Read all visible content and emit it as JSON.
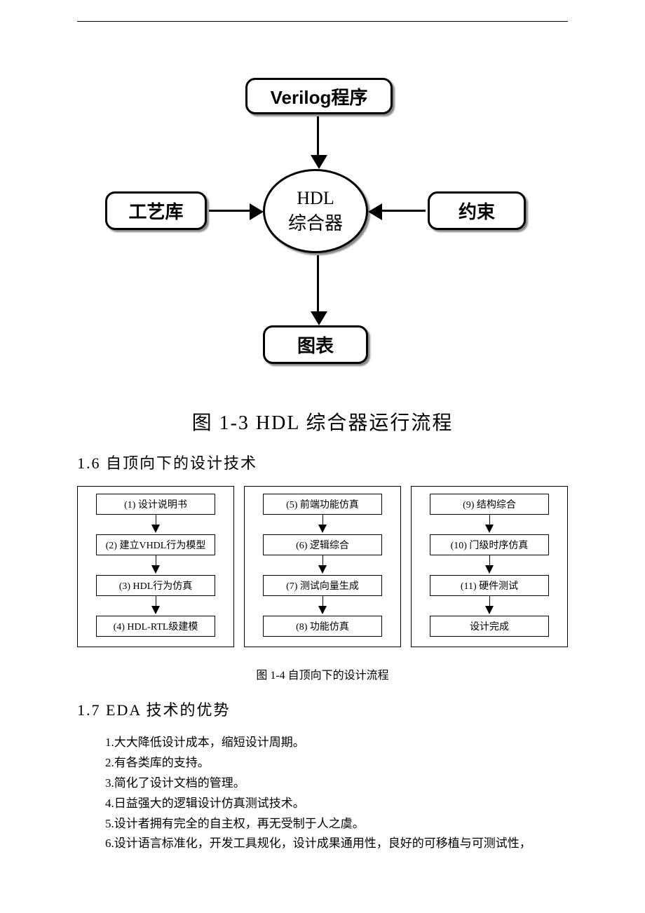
{
  "fig13": {
    "top": "Verilog程序",
    "left": "工艺库",
    "right": "约束",
    "center_line1": "HDL",
    "center_line2": "综合器",
    "bottom": "图表",
    "caption": "图 1-3   HDL 综合器运行流程"
  },
  "section16": "1.6  自顶向下的设计技术",
  "fig14": {
    "col1": [
      "(1) 设计说明书",
      "(2) 建立VHDL行为模型",
      "(3)  HDL行为仿真",
      "(4)  HDL-RTL级建模"
    ],
    "col2": [
      "(5) 前端功能仿真",
      "(6) 逻辑综合",
      "(7) 测试向量生成",
      "(8) 功能仿真"
    ],
    "col3": [
      "(9) 结构综合",
      "(10) 门级时序仿真",
      "(11) 硬件测试",
      "设计完成"
    ],
    "caption": "图 1-4   自顶向下的设计流程"
  },
  "section17": "1.7  EDA 技术的优势",
  "advantages": [
    "1.大大降低设计成本，缩短设计周期。",
    "2.有各类库的支持。",
    "3.简化了设计文档的管理。",
    "4.日益强大的逻辑设计仿真测试技术。",
    "5.设计者拥有完全的自主权，再无受制于人之虞。",
    "6.设计语言标准化，开发工具规化，设计成果通用性，良好的可移植与可测试性，"
  ]
}
